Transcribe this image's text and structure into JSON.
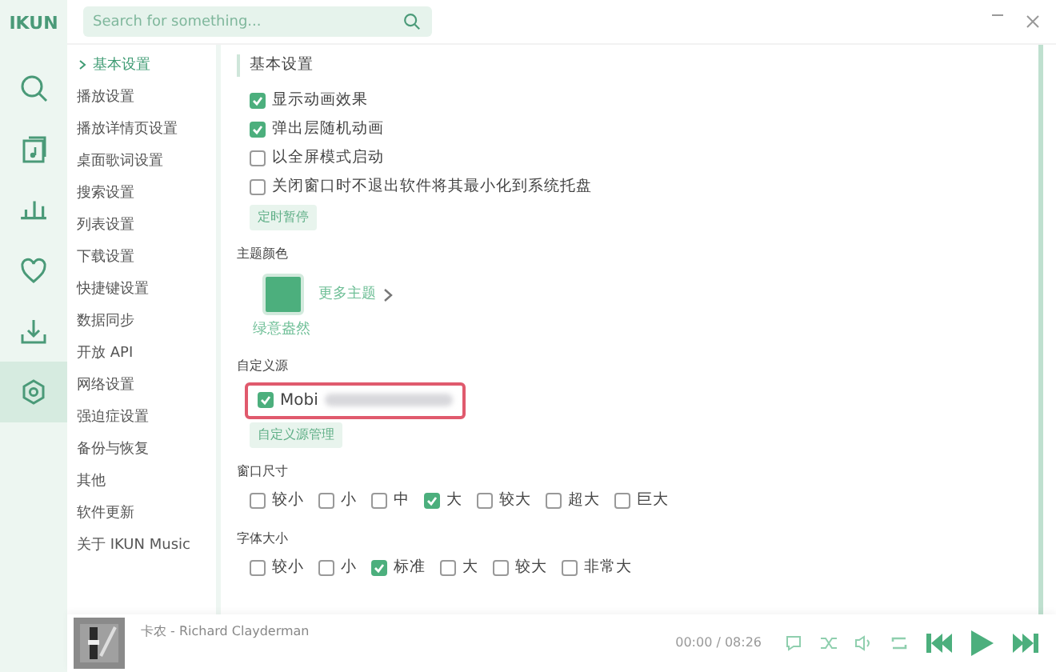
{
  "app_name": "IKUN",
  "search": {
    "placeholder": "Search for something..."
  },
  "rail": [
    {
      "kind": "search",
      "selected": false
    },
    {
      "kind": "music",
      "selected": false
    },
    {
      "kind": "chart",
      "selected": false
    },
    {
      "kind": "heart",
      "selected": false
    },
    {
      "kind": "download",
      "selected": false
    },
    {
      "kind": "settings",
      "selected": true
    }
  ],
  "nav": [
    {
      "label": "基本设置",
      "selected": true
    },
    {
      "label": "播放设置",
      "selected": false
    },
    {
      "label": "播放详情页设置",
      "selected": false
    },
    {
      "label": "桌面歌词设置",
      "selected": false
    },
    {
      "label": "搜索设置",
      "selected": false
    },
    {
      "label": "列表设置",
      "selected": false
    },
    {
      "label": "下载设置",
      "selected": false
    },
    {
      "label": "快捷键设置",
      "selected": false
    },
    {
      "label": "数据同步",
      "selected": false
    },
    {
      "label": "开放 API",
      "selected": false
    },
    {
      "label": "网络设置",
      "selected": false
    },
    {
      "label": "强迫症设置",
      "selected": false
    },
    {
      "label": "备份与恢复",
      "selected": false
    },
    {
      "label": "其他",
      "selected": false
    },
    {
      "label": "软件更新",
      "selected": false
    },
    {
      "label": "关于 IKUN Music",
      "selected": false
    }
  ],
  "section_title": "基本设置",
  "basic_options": [
    {
      "label": "显示动画效果",
      "checked": true
    },
    {
      "label": "弹出层随机动画",
      "checked": true
    },
    {
      "label": "以全屏模式启动",
      "checked": false
    },
    {
      "label": "关闭窗口时不退出软件将其最小化到系统托盘",
      "checked": false
    }
  ],
  "timer_button": "定时暂停",
  "theme": {
    "label": "主题颜色",
    "swatch_name": "绿意盎然",
    "color": "#4caf7d",
    "more": "更多主题"
  },
  "custom_source": {
    "label": "自定义源",
    "source": {
      "label": "Mobi",
      "checked": true,
      "highlighted": true
    },
    "manage_button": "自定义源管理"
  },
  "window_size": {
    "label": "窗口尺寸",
    "options": [
      {
        "label": "较小",
        "checked": false
      },
      {
        "label": "小",
        "checked": false
      },
      {
        "label": "中",
        "checked": false
      },
      {
        "label": "大",
        "checked": true
      },
      {
        "label": "较大",
        "checked": false
      },
      {
        "label": "超大",
        "checked": false
      },
      {
        "label": "巨大",
        "checked": false
      }
    ]
  },
  "font_size": {
    "label": "字体大小",
    "options": [
      {
        "label": "较小",
        "checked": false
      },
      {
        "label": "小",
        "checked": false
      },
      {
        "label": "标准",
        "checked": true
      },
      {
        "label": "大",
        "checked": false
      },
      {
        "label": "较大",
        "checked": false
      },
      {
        "label": "非常大",
        "checked": false
      }
    ]
  },
  "player": {
    "track": "卡农 - Richard Clayderman",
    "time": "00:00 / 08:26"
  }
}
